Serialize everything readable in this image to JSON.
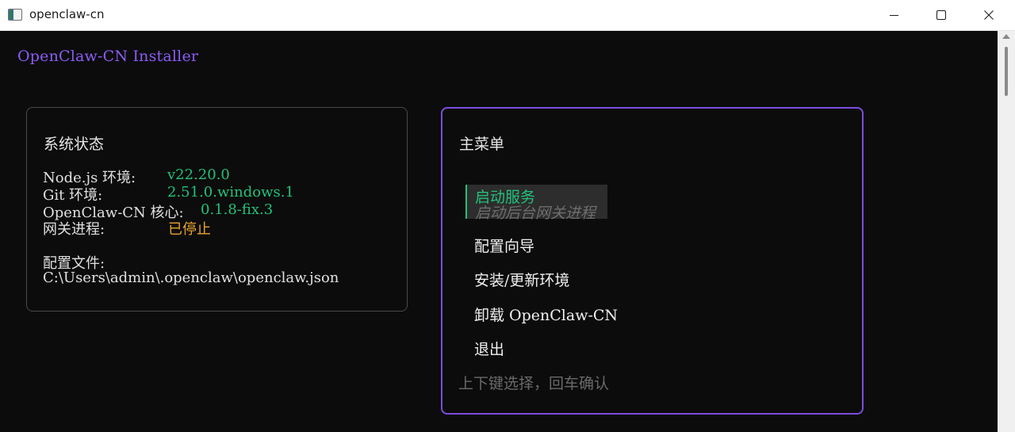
{
  "window": {
    "title": "openclaw-cn",
    "app_icon": "terminal-app-icon",
    "controls": {
      "minimize": "minimize-icon",
      "maximize": "maximize-icon",
      "close_glyph": "✕"
    }
  },
  "terminal": {
    "installer_title": "OpenClaw-CN Installer",
    "status": {
      "heading": "系统状态",
      "node_label": "Node.js 环境:",
      "node_value": "v22.20.0",
      "git_label": "Git 环境:",
      "git_value": "2.51.0.windows.1",
      "core_label": "OpenClaw-CN 核心:",
      "core_value": "0.1.8-fix.3",
      "gateway_label": "网关进程:",
      "gateway_value": "已停止",
      "config_label": "配置文件:",
      "config_path": "C:\\Users\\admin\\.openclaw\\openclaw.json"
    },
    "menu": {
      "heading": "主菜单",
      "selected": {
        "label": "启动服务",
        "description": "启动后台网关进程"
      },
      "items": [
        "配置向导",
        "安装/更新环境",
        "卸载 OpenClaw-CN",
        "退出"
      ],
      "hint": "上下键选择，回车确认"
    }
  },
  "colors": {
    "accent_purple": "#8b5cf6",
    "value_green": "#23c17a",
    "stopped_orange": "#e8a32e",
    "background": "#0c0c0c"
  }
}
